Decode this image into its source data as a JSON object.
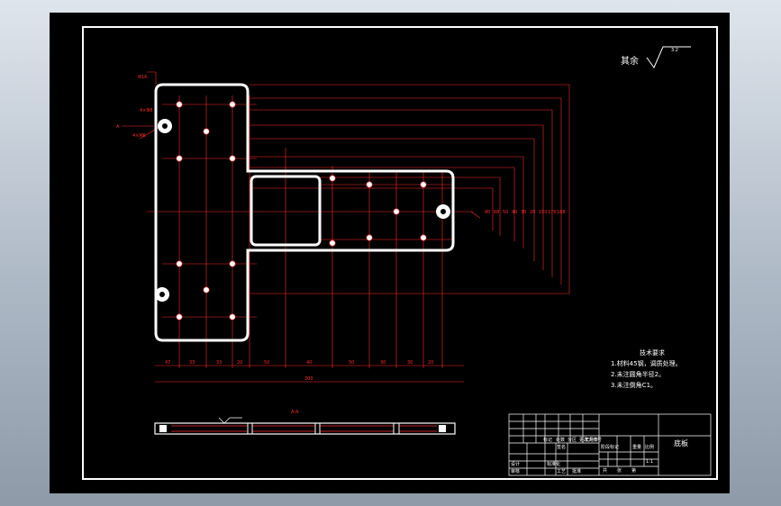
{
  "roughness_note": {
    "label": "其余",
    "value": "3.2"
  },
  "tech_notes": {
    "title": "技术要求",
    "lines": [
      "1.材料45钢，调质处理。",
      "2.未注圆角半径2。",
      "3.未注倒角C1。"
    ]
  },
  "section_label": "A-A",
  "title_block": {
    "part_name": "底板",
    "label_mark": "标记",
    "label_count": "处数",
    "label_zone": "分区",
    "label_change_no": "更改文件号",
    "label_signature": "签名",
    "label_date": "年月日",
    "label_design": "设计",
    "label_standardize": "标准化",
    "label_review": "审核",
    "label_process": "工艺",
    "label_approve": "批准",
    "label_stage_mark": "阶段标记",
    "label_weight": "重量",
    "label_scale": "比例",
    "scale_value": "1:1",
    "label_total": "共",
    "label_sheet": "张",
    "label_of": "第"
  },
  "colors": {
    "sheet": "#000000",
    "outline": "#ffffff",
    "dimension": "#ff2a2a"
  }
}
